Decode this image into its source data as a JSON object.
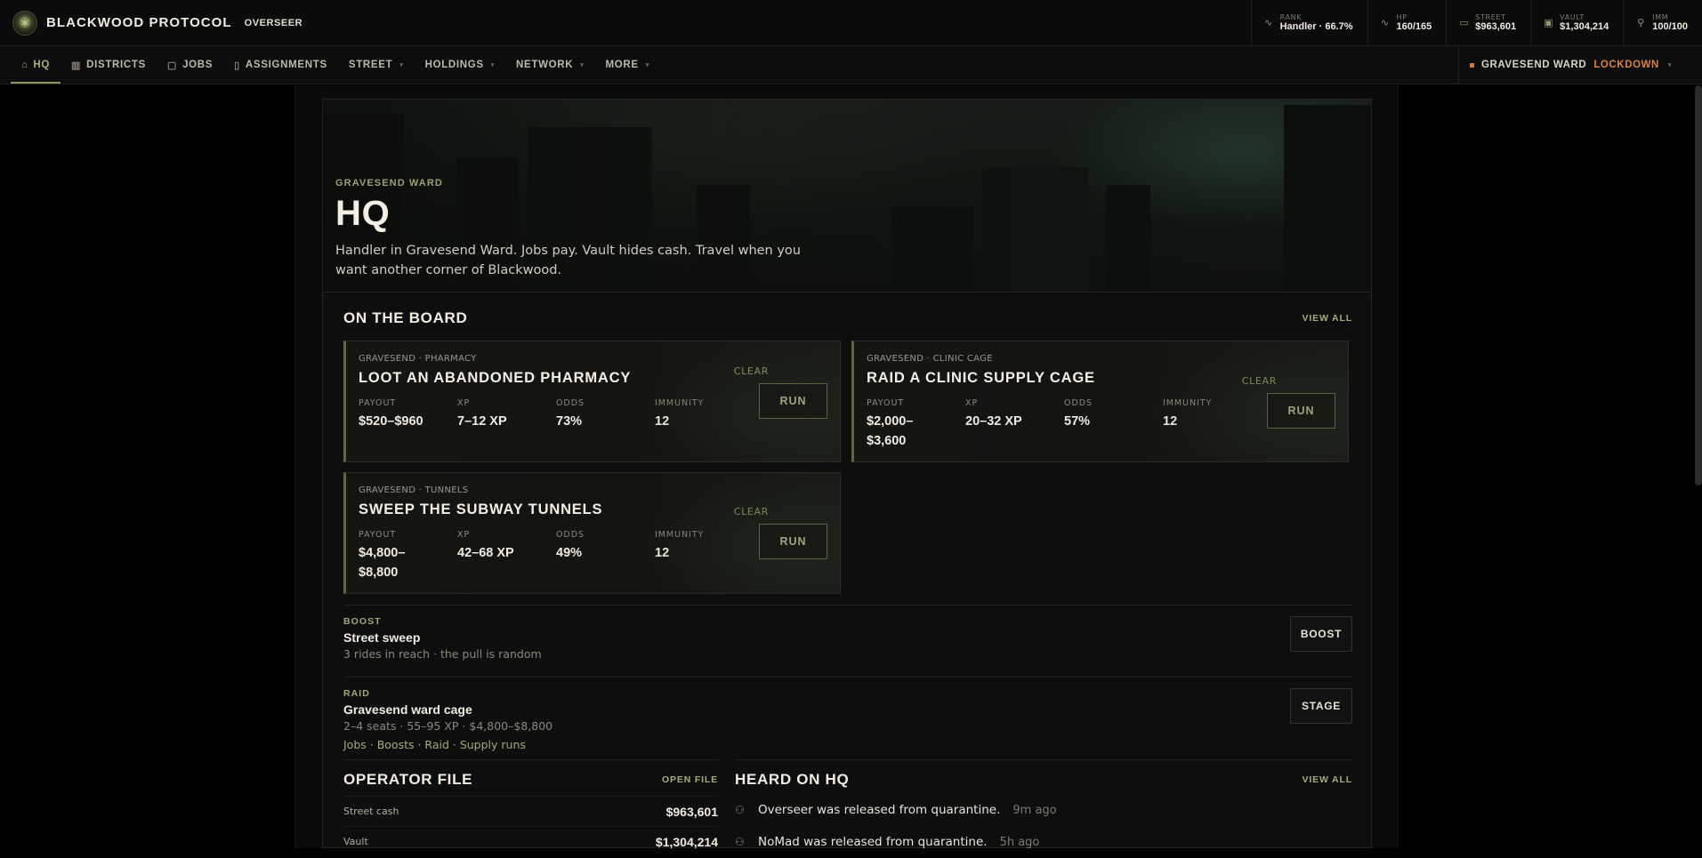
{
  "brand": {
    "name": "BLACKWOOD PROTOCOL",
    "role": "OVERSEER"
  },
  "stats": [
    {
      "key": "RANK",
      "value": "Handler · 66.7%",
      "icon": "pulse-icon"
    },
    {
      "key": "HP",
      "value": "160/165",
      "icon": "heartbeat-icon"
    },
    {
      "key": "STREET",
      "value": "$963,601",
      "icon": "cash-icon"
    },
    {
      "key": "VAULT",
      "value": "$1,304,214",
      "icon": "vault-icon"
    },
    {
      "key": "IMM",
      "value": "100/100",
      "icon": "syringe-icon"
    }
  ],
  "nav": {
    "items": [
      {
        "label": "HQ",
        "icon": "home-icon"
      },
      {
        "label": "DISTRICTS",
        "icon": "map-icon"
      },
      {
        "label": "JOBS",
        "icon": "briefcase-icon"
      },
      {
        "label": "ASSIGNMENTS",
        "icon": "document-icon"
      },
      {
        "label": "STREET"
      },
      {
        "label": "HOLDINGS"
      },
      {
        "label": "NETWORK"
      },
      {
        "label": "MORE"
      }
    ],
    "lockdown": {
      "ward": "GRAVESEND WARD",
      "status": "LOCKDOWN",
      "status_color": "#d9823a"
    }
  },
  "hero": {
    "ward": "GRAVESEND WARD",
    "title": "HQ",
    "description": "Handler in Gravesend Ward. Jobs pay. Vault hides cash. Travel when you want another corner of Blackwood."
  },
  "board": {
    "title": "ON THE BOARD",
    "view_all": "VIEW ALL",
    "stat_labels": {
      "payout": "PAYOUT",
      "xp": "XP",
      "odds": "ODDS",
      "immunity": "IMMUNITY"
    },
    "jobs": [
      {
        "tag": "GRAVESEND · PHARMACY",
        "title": "LOOT AN ABANDONED PHARMACY",
        "payout": "$520–$960",
        "xp": "7–12 XP",
        "odds": "73%",
        "immunity": "12",
        "status": "CLEAR",
        "action": "RUN"
      },
      {
        "tag": "GRAVESEND · CLINIC CAGE",
        "title": "RAID A CLINIC SUPPLY CAGE",
        "payout": "$2,000–$3,600",
        "xp": "20–32 XP",
        "odds": "57%",
        "immunity": "12",
        "status": "CLEAR",
        "action": "RUN"
      },
      {
        "tag": "GRAVESEND · TUNNELS",
        "title": "SWEEP THE SUBWAY TUNNELS",
        "payout": "$4,800–$8,800",
        "xp": "42–68 XP",
        "odds": "49%",
        "immunity": "12",
        "status": "CLEAR",
        "action": "RUN"
      }
    ]
  },
  "boost": {
    "kicker": "BOOST",
    "title": "Street sweep",
    "desc": "3 rides in reach · the pull is random",
    "button": "BOOST"
  },
  "raid": {
    "kicker": "RAID",
    "title": "Gravesend ward cage",
    "desc": "2–4 seats · 55–95 XP · $4,800–$8,800",
    "links": "Jobs · Boosts · Raid · Supply runs",
    "button": "STAGE"
  },
  "operator": {
    "title": "OPERATOR FILE",
    "link": "OPEN FILE",
    "rows": [
      {
        "label": "Street cash",
        "value": "$963,601"
      },
      {
        "label": "Vault",
        "value": "$1,304,214"
      }
    ]
  },
  "heard": {
    "title": "HEARD ON HQ",
    "link": "VIEW ALL",
    "items": [
      {
        "message": "Overseer was released from quarantine.",
        "time": "9m ago"
      },
      {
        "message": "NoMad was released from quarantine.",
        "time": "5h ago"
      }
    ]
  }
}
